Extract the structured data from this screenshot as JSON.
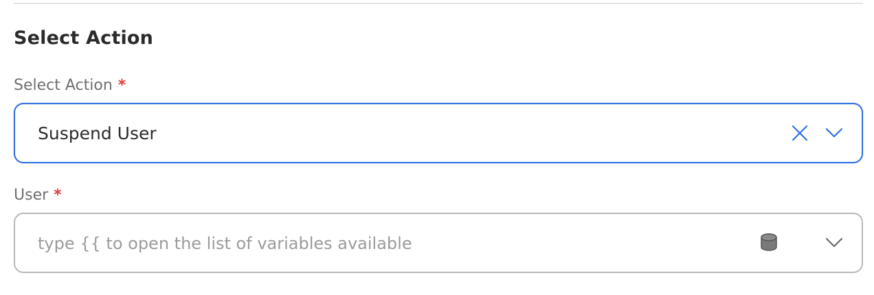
{
  "section": {
    "title": "Select Action"
  },
  "action_field": {
    "label": "Select Action",
    "required_mark": "*",
    "value": "Suspend User",
    "clear_icon": "close-icon",
    "dropdown_icon": "chevron-down-icon"
  },
  "user_field": {
    "label": "User",
    "required_mark": "*",
    "value": "",
    "placeholder": "type {{ to open the list of variables available",
    "variables_icon": "database-icon",
    "dropdown_icon": "chevron-down-icon"
  },
  "colors": {
    "accent": "#2e6fe0",
    "required": "#e23c3c",
    "label": "#6f6f6f",
    "border": "#b7b7b7"
  }
}
